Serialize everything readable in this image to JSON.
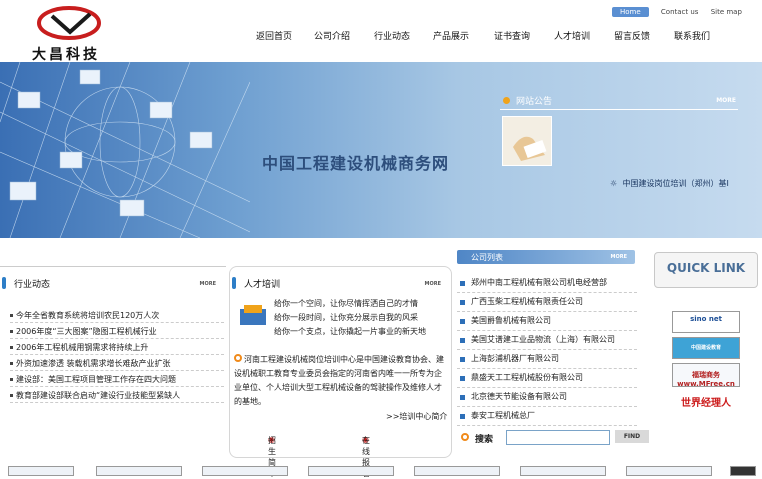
{
  "header": {
    "logo_text": "大昌科技",
    "toplinks": {
      "home": "Home",
      "contact": "Contact us",
      "sitemap": "Site map"
    },
    "nav": [
      "返回首页",
      "公司介绍",
      "行业动态",
      "产品展示",
      "证书查询",
      "人才培训",
      "留言反馈",
      "联系我们"
    ]
  },
  "banner": {
    "title": "中国工程建设机械商务网",
    "notice": {
      "heading": "网站公告",
      "more": "MORE",
      "text": "中国建设岗位培训（郑州）基I"
    }
  },
  "news": {
    "heading": "行业动态",
    "more": "MORE",
    "items": [
      "今年全省教育系统将培训农民120万人次",
      "2006年度“三大图案”隐图工程机械行业",
      "2006年工程机械用钢需求将持续上升",
      "外资加速渗透 装载机需求增长难敌产业扩张",
      "建设部：美国工程项目管理工作存在四大问题",
      "教育部建设部联合启动“建设行业技能型紧缺人"
    ]
  },
  "talent": {
    "heading": "人才培训",
    "more": "MORE",
    "lines": [
      "给你一个空间，让你尽情挥洒自己的才情",
      "给你一段时间，让你充分展示自我的风采",
      "给你一个支点，让你撬起一片事业的新天地"
    ],
    "intro": "河南工程建设机械岗位培训中心是中国建设教育协会、建设机械职工教育专业委员会指定的河南省内唯一一所专为企业单位、个人培训大型工程机械设备的驾驶操作及维修人才的基地。",
    "more_link": ">>培训中心简介",
    "actions": [
      "招生简章",
      "在线报名"
    ]
  },
  "companies": {
    "heading": "公司列表",
    "more": "MORE",
    "items": [
      "郑州中南工程机械有限公司机电经营部",
      "广西玉柴工程机械有限责任公司",
      "美国爵鲁机械有限公司",
      "美国艾谱建工业品物流（上海）有限公司",
      "上海彭浦机器厂有限公司",
      "鼎盛天工工程机械股份有限公司",
      "北京德天节能设备有限公司",
      "泰安工程机械总厂"
    ]
  },
  "search": {
    "label": "搜索",
    "value": "",
    "button": "FIND"
  },
  "quicklink": {
    "label": "QUICK LINK"
  },
  "ads": [
    "sino net",
    "中国建设教育",
    "福瑞商务 www.MFree.cn",
    "世界经理人"
  ],
  "colors": {
    "accent": "#2d7ec7",
    "banner_start": "#3a6fb4",
    "banner_end": "#c6dbef",
    "title": "#2d4e7c"
  }
}
